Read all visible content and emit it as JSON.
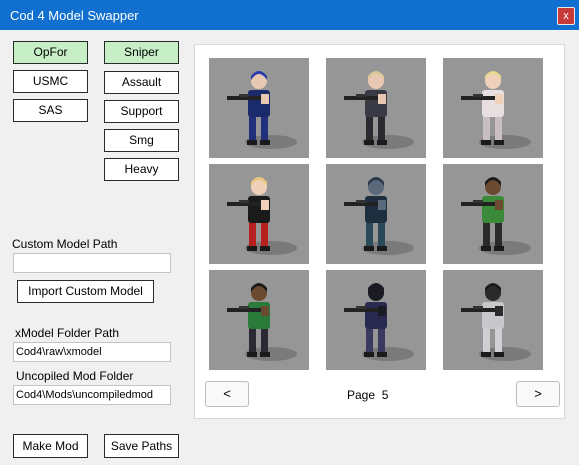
{
  "window": {
    "title": "Cod 4 Model Swapper",
    "close_label": "x"
  },
  "faction_buttons": [
    {
      "label": "OpFor",
      "selected": true
    },
    {
      "label": "USMC",
      "selected": false
    },
    {
      "label": "SAS",
      "selected": false
    }
  ],
  "class_buttons": [
    {
      "label": "Sniper",
      "selected": true
    },
    {
      "label": "Assault",
      "selected": false
    },
    {
      "label": "Support",
      "selected": false
    },
    {
      "label": "Smg",
      "selected": false
    },
    {
      "label": "Heavy",
      "selected": false
    }
  ],
  "custom_model": {
    "label": "Custom Model Path",
    "value": "",
    "import_label": "Import Custom Model"
  },
  "xmodel_folder": {
    "label": "xModel Folder Path",
    "value": "Cod4\\raw\\xmodel"
  },
  "mod_folder": {
    "label": "Uncopiled Mod Folder",
    "value": "Cod4\\Mods\\uncompiledmod"
  },
  "actions": {
    "make_mod_label": "Make Mod",
    "save_paths_label": "Save Paths"
  },
  "pager": {
    "prev_label": "<",
    "next_label": ">",
    "page_label": "Page",
    "page_number": "5"
  },
  "colors": {
    "titlebar": "#1170cf",
    "selected_button": "#c6efc6",
    "thumb_bg": "#969696"
  },
  "models": [
    {
      "icon": "blue-hair-soldier-icon",
      "hair": "#2a3aa8",
      "body": "#1a2a6a",
      "legs": "#20307a",
      "skin": "#e8c8b0"
    },
    {
      "icon": "blonde-sniper-icon",
      "hair": "#d8c898",
      "body": "#3a3a44",
      "legs": "#2a2a30",
      "skin": "#e8c8b0"
    },
    {
      "icon": "white-outfit-soldier-icon",
      "hair": "#e8d890",
      "body": "#e8e0e0",
      "legs": "#c8c0c0",
      "skin": "#f0d0b8"
    },
    {
      "icon": "red-outfit-soldier-icon",
      "hair": "#e8c880",
      "body": "#1a1a1a",
      "legs": "#b82020",
      "skin": "#f0d0b8"
    },
    {
      "icon": "dark-armor-soldier-icon",
      "hair": "#2a3a4a",
      "body": "#1e2e3e",
      "legs": "#2a4a5a",
      "skin": "#5a6a7a"
    },
    {
      "icon": "green-shirt-soldier-icon",
      "hair": "#1a1a1a",
      "body": "#3a8a3a",
      "legs": "#2a2a2a",
      "skin": "#6a4a30"
    },
    {
      "icon": "green-tank-soldier-icon",
      "hair": "#1a1a1a",
      "body": "#2a7a3a",
      "legs": "#2a2a34",
      "skin": "#6a4a30"
    },
    {
      "icon": "masked-navy-soldier-icon",
      "hair": "#1a1a24",
      "body": "#2a2a50",
      "legs": "#3a3a60",
      "skin": "#1a1a24"
    },
    {
      "icon": "snow-camo-soldier-icon",
      "hair": "#1a1a1a",
      "body": "#c8c8cc",
      "legs": "#d0d0d4",
      "skin": "#2a2a2a"
    }
  ]
}
